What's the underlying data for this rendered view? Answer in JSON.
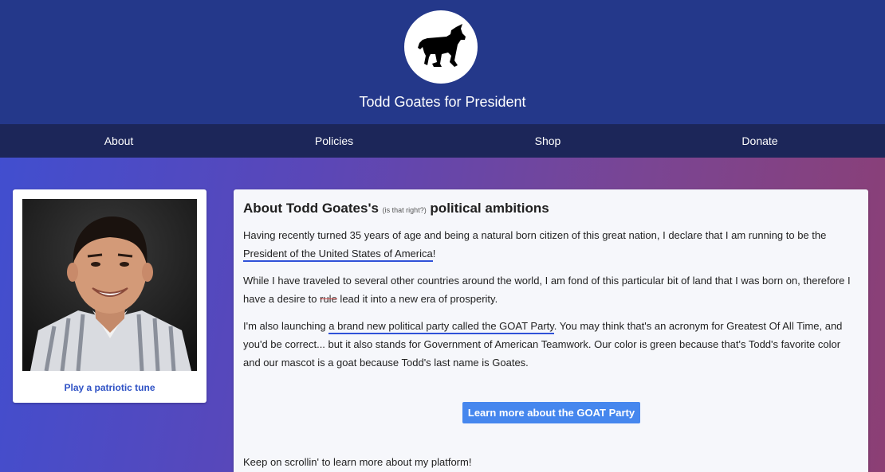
{
  "header": {
    "site_title": "Todd Goates for President",
    "logo_icon": "goat-icon"
  },
  "nav": {
    "items": [
      {
        "label": "About"
      },
      {
        "label": "Policies"
      },
      {
        "label": "Shop"
      },
      {
        "label": "Donate"
      }
    ]
  },
  "sidebar": {
    "photo_icon": "portrait-photo",
    "tune_link": "Play a patriotic tune"
  },
  "main": {
    "heading_pre": "About Todd Goates's ",
    "heading_aside": "(is that right?)",
    "heading_post": " political ambitions",
    "p1_text": "Having recently turned 35 years of age and being a natural born citizen of this great nation, I declare that I am running to be the ",
    "p1_link": "President of the United States of America",
    "p1_end": "!",
    "p2_a": "While I have traveled to several other countries around the world, I am fond of this particular bit of land that I was born on, therefore I have a desire to ",
    "p2_strike": "rule",
    "p2_b": " lead it into a new era of prosperity.",
    "p3_a": "I'm also launching ",
    "p3_link": "a brand new political party called the GOAT Party",
    "p3_b": ". You may think that's an acronym for Greatest Of All Time, and you'd be correct... but it also stands for Government of American Teamwork. Our color is green because that's Todd's favorite color and our mascot is a goat because Todd's last name is Goates.",
    "cta_label": "Learn more about the GOAT Party",
    "p4": "Keep on scrollin' to learn more about my platform!"
  },
  "colors": {
    "header_bg": "#24388a",
    "nav_bg": "#1c2659",
    "link_underline": "#3052d8",
    "button_bg": "#4687ee",
    "tune_link": "#2f52c5"
  }
}
